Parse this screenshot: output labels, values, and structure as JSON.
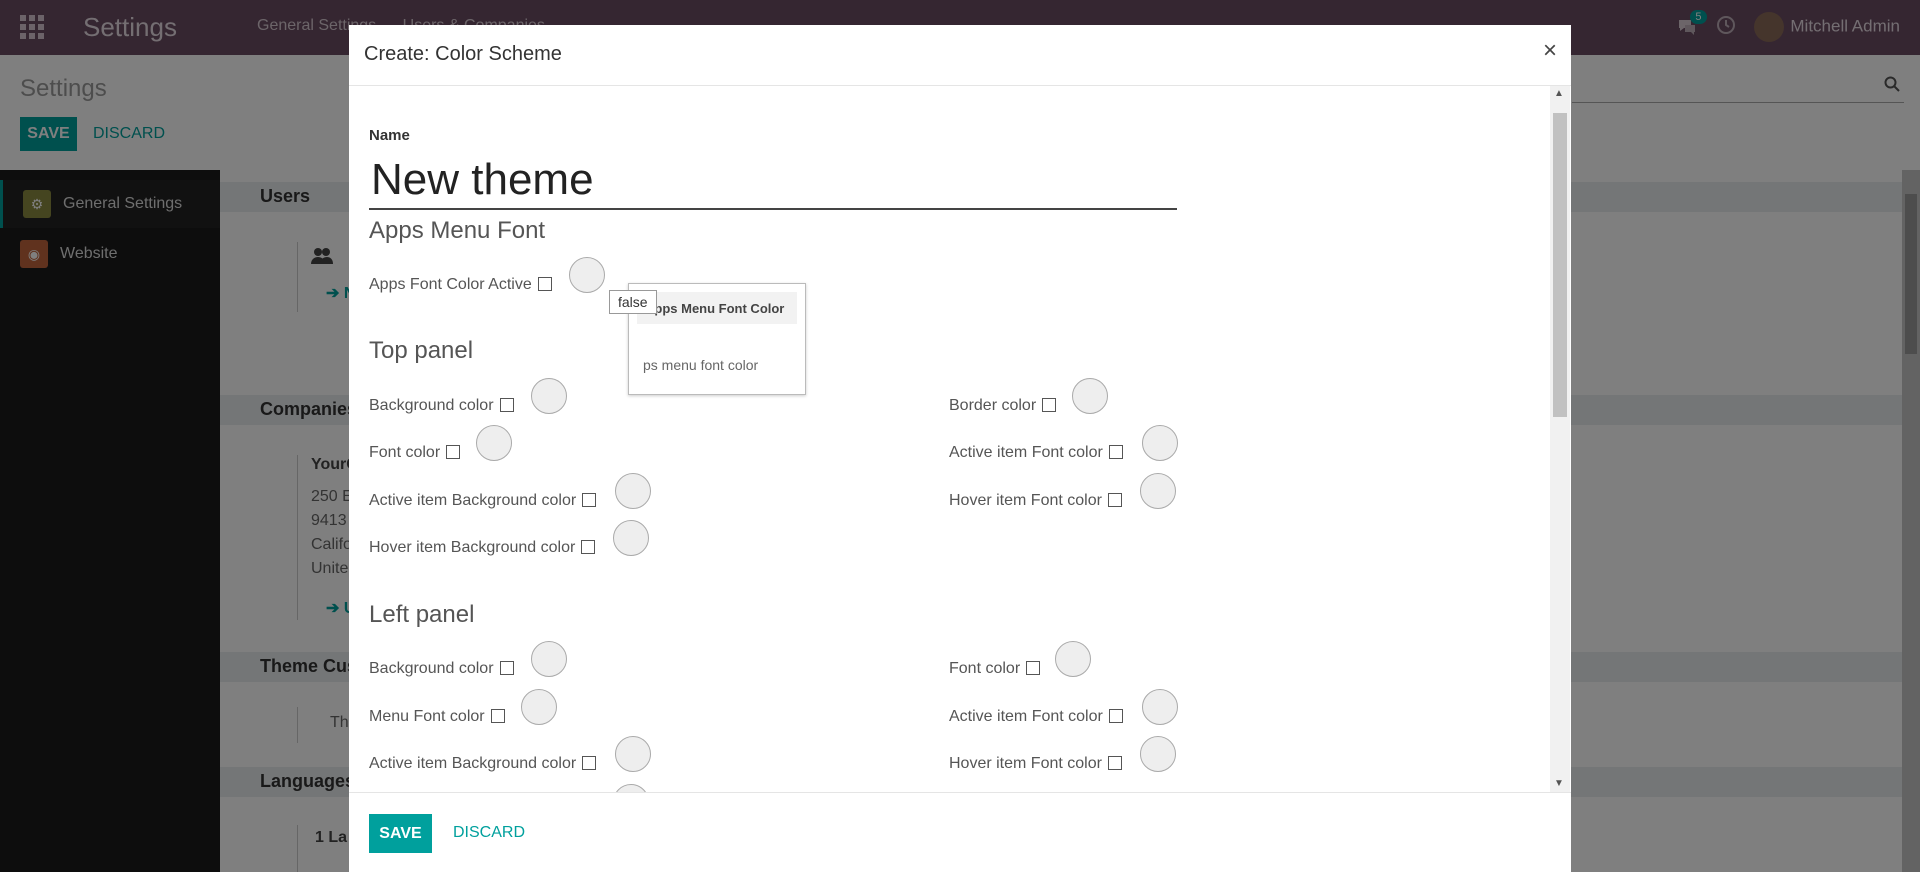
{
  "navbar": {
    "brand": "Settings",
    "menu": [
      "General Settings",
      "Users & Companies"
    ],
    "chat_count": "5",
    "user": "Mitchell Admin"
  },
  "control_panel": {
    "title": "Settings",
    "save": "SAVE",
    "discard": "DISCARD"
  },
  "sidebar": {
    "items": [
      {
        "label": "General Settings",
        "icon": "gear-icon",
        "color": "#8a8a40"
      },
      {
        "label": "Website",
        "icon": "globe-icon",
        "color": "#c0643c"
      }
    ]
  },
  "background": {
    "sections": [
      "Users",
      "Companies",
      "Theme Cus",
      "Languages"
    ],
    "company_lines": [
      "YourC",
      "250 E",
      "9413",
      "Califo",
      "Unite"
    ],
    "links": [
      "N",
      "U"
    ],
    "theme_text": "Th",
    "lang_text": "1 La"
  },
  "modal": {
    "title": "Create: Color Scheme",
    "close": "×",
    "name_label": "Name",
    "name_value": "New theme",
    "apps_menu_font": {
      "heading": "Apps Menu Font",
      "field": "Apps Font Color Active"
    },
    "tooltip": {
      "title": "Apps Menu Font Color",
      "text": "ps menu font color",
      "value": "false"
    },
    "top_panel": {
      "heading": "Top panel",
      "left": [
        "Background color",
        "Font color",
        "Active item Background color",
        "Hover item Background color"
      ],
      "right": [
        "Border color",
        "Active item Font color",
        "Hover item Font color"
      ]
    },
    "left_panel": {
      "heading": "Left panel",
      "left": [
        "Background color",
        "Menu Font color",
        "Active item Background color"
      ],
      "right": [
        "Font color",
        "Active item Font color",
        "Hover item Font color"
      ]
    },
    "footer": {
      "save": "SAVE",
      "discard": "DISCARD"
    }
  },
  "colors": {
    "navbar": "#6a4c63",
    "accent": "#00a09d",
    "sidebar": "#1b1b1b"
  }
}
